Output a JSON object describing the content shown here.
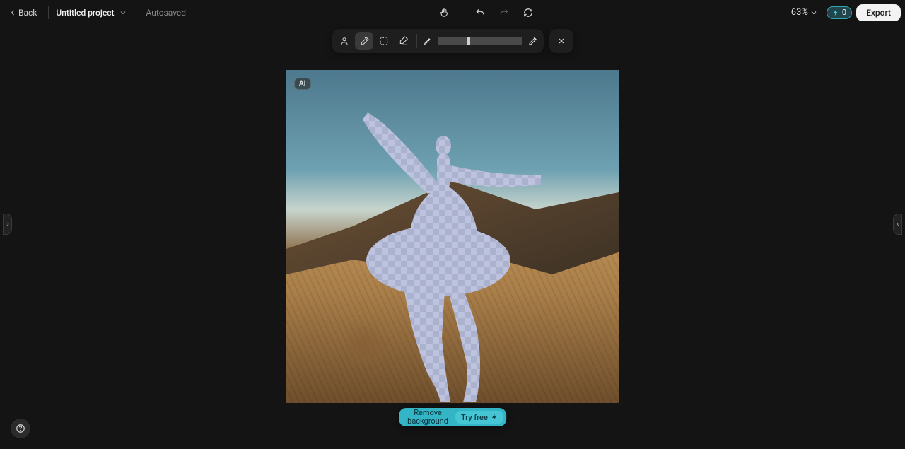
{
  "topbar": {
    "back_label": "Back",
    "project_title": "Untitled project",
    "autosaved": "Autosaved",
    "zoom_label": "63%",
    "credits_value": "0",
    "export_label": "Export"
  },
  "toolbar": {
    "brush_slider_value": 35
  },
  "canvas": {
    "ai_badge": "AI"
  },
  "footer": {
    "remove_bg_line1": "Remove",
    "remove_bg_line2": "background",
    "try_free_label": "Try free"
  }
}
